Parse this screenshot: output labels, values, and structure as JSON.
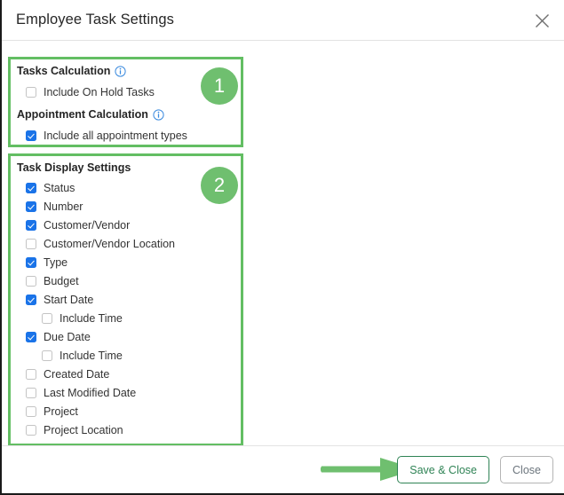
{
  "dialog": {
    "title": "Employee Task Settings",
    "close_icon": "close-icon"
  },
  "colors": {
    "annotation_green": "#63be63",
    "badge_green": "#6fbf6f",
    "arrow_green": "#6fbf6f",
    "checkbox_blue": "#1a73e8",
    "save_button_green": "#2f8355",
    "close_button_gray": "#6c757d"
  },
  "sections": [
    {
      "badge": "1",
      "heading_1": "Tasks Calculation",
      "heading_1_icon": "info-icon",
      "heading_2": "Appointment Calculation",
      "heading_2_icon": "info-icon",
      "options": [
        {
          "label": "Include On Hold Tasks",
          "checked": false
        },
        {
          "label": "Include all appointment types",
          "checked": true
        }
      ]
    },
    {
      "badge": "2",
      "heading": "Task Display Settings",
      "options": [
        {
          "label": "Status",
          "checked": true,
          "indent": false
        },
        {
          "label": "Number",
          "checked": true,
          "indent": false
        },
        {
          "label": "Customer/Vendor",
          "checked": true,
          "indent": false
        },
        {
          "label": "Customer/Vendor Location",
          "checked": false,
          "indent": false
        },
        {
          "label": "Type",
          "checked": true,
          "indent": false
        },
        {
          "label": "Budget",
          "checked": false,
          "indent": false
        },
        {
          "label": "Start Date",
          "checked": true,
          "indent": false
        },
        {
          "label": "Include Time",
          "checked": false,
          "indent": true
        },
        {
          "label": "Due Date",
          "checked": true,
          "indent": false
        },
        {
          "label": "Include Time",
          "checked": false,
          "indent": true
        },
        {
          "label": "Created Date",
          "checked": false,
          "indent": false
        },
        {
          "label": "Last Modified Date",
          "checked": false,
          "indent": false
        },
        {
          "label": "Project",
          "checked": false,
          "indent": false
        },
        {
          "label": "Project Location",
          "checked": false,
          "indent": false
        }
      ]
    }
  ],
  "footer": {
    "save_label": "Save & Close",
    "close_label": "Close",
    "annotation_arrow": "arrow-right-annotation"
  }
}
